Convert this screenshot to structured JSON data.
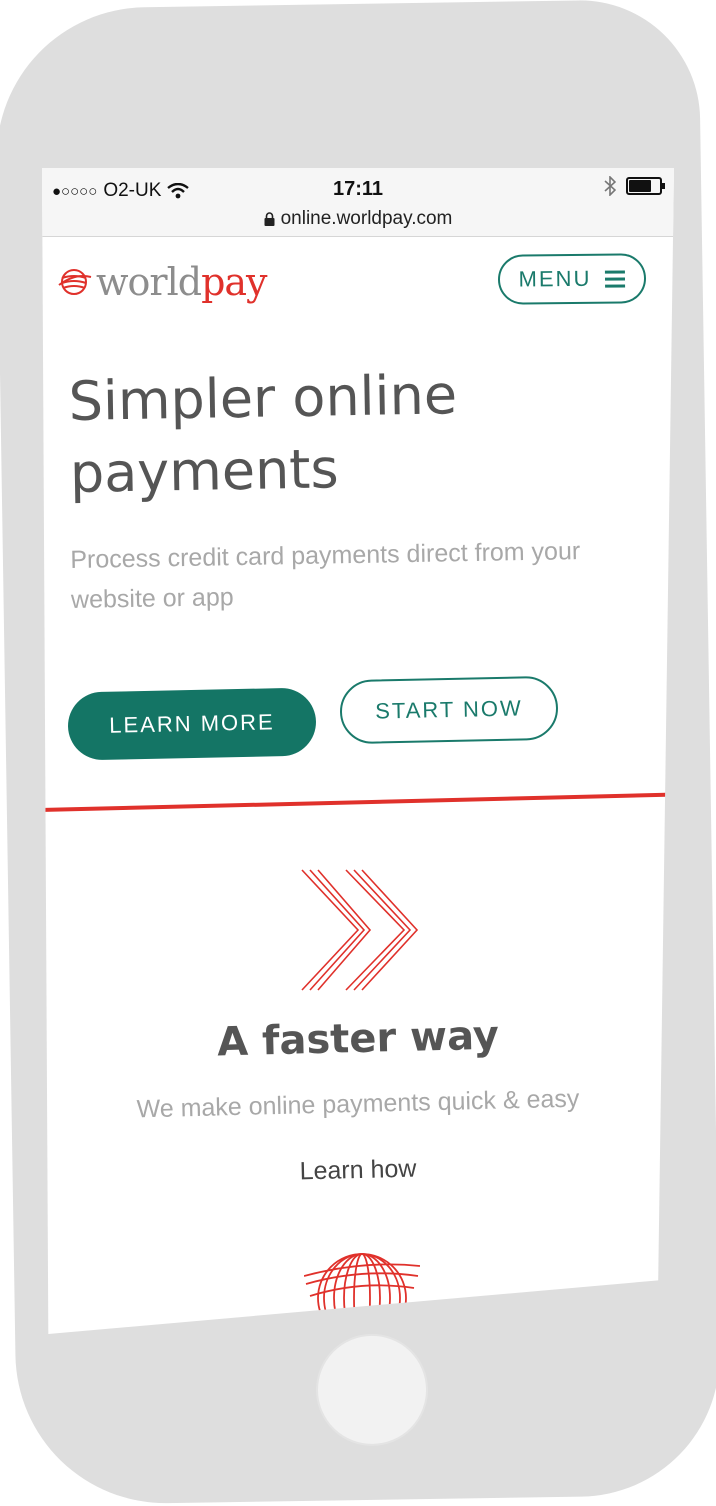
{
  "status_bar": {
    "signal": "●○○○○",
    "carrier": "O2-UK",
    "time": "17:11",
    "url": "online.worldpay.com",
    "battery_level": 0.7
  },
  "header": {
    "logo_world": "world",
    "logo_pay": "pay",
    "menu_label": "MENU"
  },
  "hero": {
    "title": "Simpler online payments",
    "subtitle": "Process credit card payments direct from your website or app",
    "primary_button": "LEARN MORE",
    "secondary_button": "START NOW"
  },
  "feature": {
    "title": "A faster way",
    "subtitle": "We make online payments quick & easy",
    "link": "Learn how"
  },
  "colors": {
    "accent_green": "#147565",
    "brand_red": "#e0312b",
    "heading_gray": "#555555",
    "sub_gray": "#a8a8a8"
  },
  "icons": [
    "wifi-icon",
    "lock-icon",
    "bluetooth-icon",
    "battery-icon",
    "globe-logo-icon",
    "menu-icon",
    "double-chevron-icon",
    "globe-icon"
  ]
}
